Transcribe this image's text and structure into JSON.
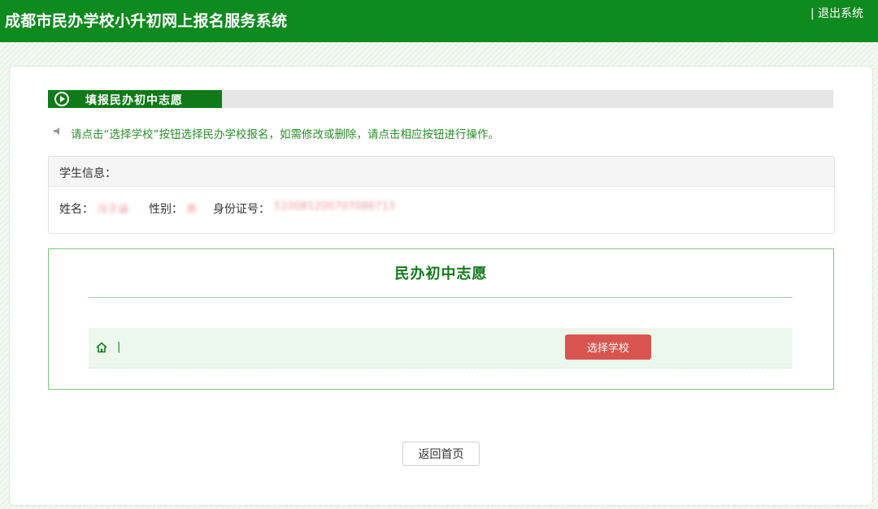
{
  "header": {
    "title": "成都市民办学校小升初网上报名服务系统",
    "logout_label": "| 退出系统"
  },
  "section": {
    "title": "填报民办初中志愿"
  },
  "notice": {
    "text": "请点击“选择学校”按钮选择民办学校报名，如需修改或删除，请点击相应按钮进行操作。"
  },
  "student": {
    "card_title": "学生信息：",
    "name_label": "姓名：",
    "name_value": "冯子涵",
    "gender_label": "性别：",
    "gender_value": "男",
    "id_label": "身份证号：",
    "id_value": "510081200707086713"
  },
  "choice": {
    "title": "民办初中志愿",
    "row_separator": "|",
    "select_button_label": "选择学校"
  },
  "footer": {
    "back_button_label": "返回首页"
  },
  "colors": {
    "brand_green": "#0f8a1f",
    "accent_red": "#d9534f"
  },
  "icons": {
    "section": "play-circle-icon",
    "notice": "speaker-icon",
    "row": "home-icon"
  }
}
